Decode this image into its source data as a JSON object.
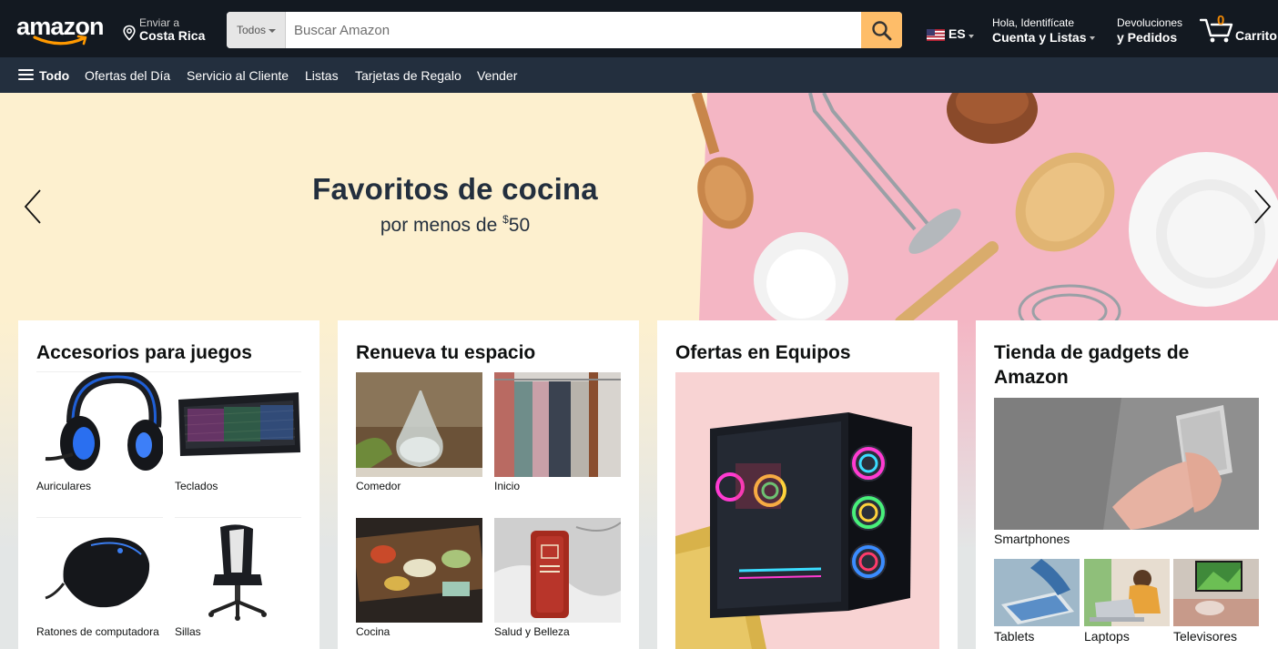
{
  "header": {
    "logo_text": "amazon",
    "deliver_line1": "Enviar a",
    "deliver_line2": "Costa Rica",
    "search_category": "Todos",
    "search_placeholder": "Buscar Amazon",
    "language": "ES",
    "account_line1": "Hola, Identifícate",
    "account_line2": "Cuenta y Listas",
    "returns_line1": "Devoluciones",
    "returns_line2": "y Pedidos",
    "cart_count": "0",
    "cart_label": "Carrito"
  },
  "subnav": {
    "all_label": "Todo",
    "items": [
      "Ofertas del Día",
      "Servicio al Cliente",
      "Listas",
      "Tarjetas de Regalo",
      "Vender"
    ]
  },
  "hero": {
    "title": "Favoritos de cocina",
    "subtitle_prefix": "por menos de ",
    "currency": "$",
    "amount": "50"
  },
  "cards": {
    "gaming": {
      "title": "Accesorios para juegos",
      "items": [
        "Auriculares",
        "Teclados",
        "Ratones de computadora",
        "Sillas"
      ]
    },
    "home": {
      "title": "Renueva tu espacio",
      "items": [
        "Comedor",
        "Inicio",
        "Cocina",
        "Salud y Belleza"
      ]
    },
    "computers": {
      "title": "Ofertas en Equipos"
    },
    "gadgets": {
      "title_line1": "Tienda de gadgets de",
      "title_line2": "Amazon",
      "items": [
        "Smartphones",
        "Tablets",
        "Laptops",
        "Televisores"
      ]
    }
  },
  "colors": {
    "nav_dark": "#131921",
    "subnav": "#232f3e",
    "search_button": "#febd69",
    "cart_count": "#f08804",
    "hero_cream": "#fdf0cf",
    "hero_pink": "#f4b6c4"
  }
}
